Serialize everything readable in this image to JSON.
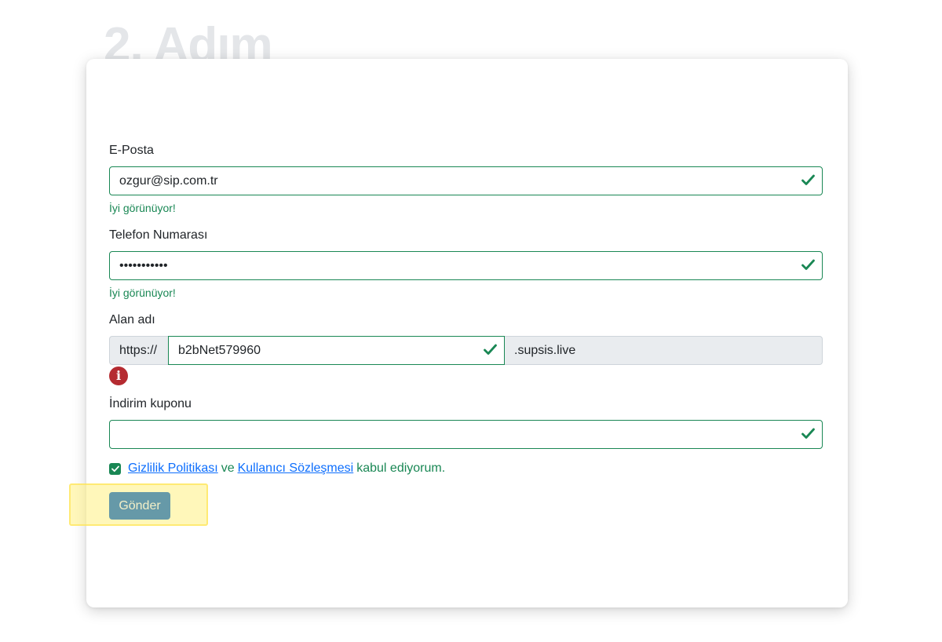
{
  "step": {
    "title": "2. Adım"
  },
  "form": {
    "email": {
      "label": "E-Posta",
      "value": "ozgur@sip.com.tr",
      "feedback": "İyi görünüyor!"
    },
    "phone": {
      "label": "Telefon Numarası",
      "value": "•••••••••••",
      "feedback": "İyi görünüyor!"
    },
    "domain": {
      "label": "Alan adı",
      "prefix": "https://",
      "value": "b2bNet579960",
      "suffix": ".supsis.live",
      "error_icon_glyph": "i"
    },
    "coupon": {
      "label": "İndirim kuponu",
      "value": ""
    },
    "terms": {
      "checked": true,
      "privacy_link": "Gizlilik Politikası",
      "and_text": "ve",
      "agreement_link": "Kullanıcı Sözleşmesi",
      "accept_text": "kabul ediyorum."
    },
    "submit_label": "Gönder"
  },
  "colors": {
    "valid": "#198754",
    "error": "#b52b31",
    "link": "#0d6efd",
    "button": "#6699a8",
    "highlight": "#fff082"
  }
}
